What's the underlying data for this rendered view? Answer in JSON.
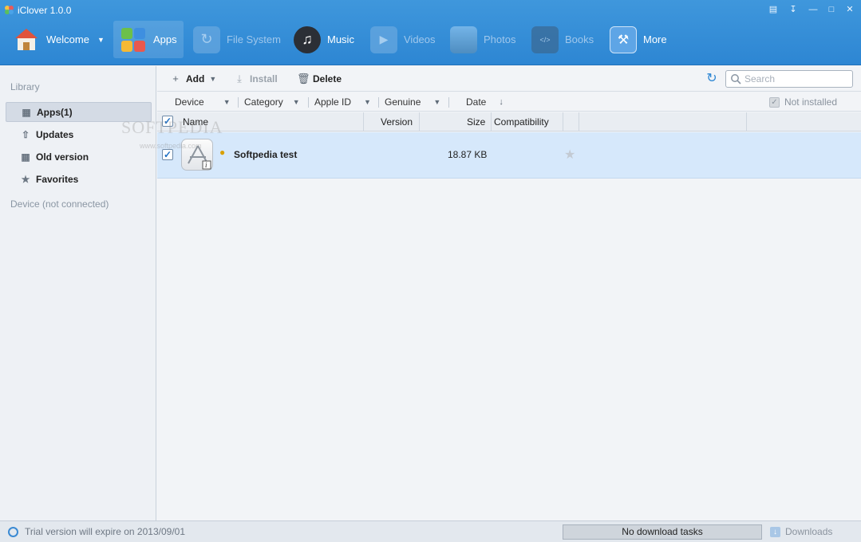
{
  "window": {
    "title": "iClover 1.0.0"
  },
  "nav": {
    "items": [
      {
        "label": "Welcome",
        "icon": "home-icon",
        "state": "normal"
      },
      {
        "label": "Apps",
        "icon": "apps-icon",
        "state": "active"
      },
      {
        "label": "File System",
        "icon": "file-system-icon",
        "state": "disabled"
      },
      {
        "label": "Music",
        "icon": "music-icon",
        "state": "normal"
      },
      {
        "label": "Videos",
        "icon": "videos-icon",
        "state": "disabled"
      },
      {
        "label": "Photos",
        "icon": "photos-icon",
        "state": "disabled"
      },
      {
        "label": "Books",
        "icon": "books-icon",
        "state": "disabled"
      },
      {
        "label": "More",
        "icon": "tools-icon",
        "state": "normal"
      }
    ]
  },
  "sidebar": {
    "library_heading": "Library",
    "items": [
      {
        "label": "Apps(1)",
        "icon": "grid-icon",
        "active": true
      },
      {
        "label": "Updates",
        "icon": "arrow-up-icon",
        "active": false
      },
      {
        "label": "Old version",
        "icon": "grid-icon",
        "active": false
      },
      {
        "label": "Favorites",
        "icon": "star-icon",
        "active": false
      }
    ],
    "device_heading": "Device (not connected)"
  },
  "toolbar": {
    "add_label": "Add",
    "install_label": "Install",
    "delete_label": "Delete",
    "search_placeholder": "Search"
  },
  "filters": {
    "device": "Device",
    "category": "Category",
    "apple_id": "Apple ID",
    "genuine": "Genuine",
    "date": "Date",
    "not_installed": "Not installed"
  },
  "table": {
    "columns": {
      "name": "Name",
      "version": "Version",
      "size": "Size",
      "compatibility": "Compatibility"
    },
    "rows": [
      {
        "name": "Softpedia test",
        "version": "",
        "size": "18.87 KB",
        "compatibility": "",
        "checked": true,
        "favorite": false
      }
    ]
  },
  "watermark": {
    "text": "SOFTPEDIA",
    "url": "www.softpedia.com"
  },
  "status": {
    "trial_text": "Trial version will expire on 2013/09/01",
    "tasks_text": "No download tasks",
    "downloads_label": "Downloads"
  },
  "colors": {
    "header": "#2d86d3",
    "row_selected": "#d6e8fb",
    "sidebar_bg": "#eef1f5"
  }
}
